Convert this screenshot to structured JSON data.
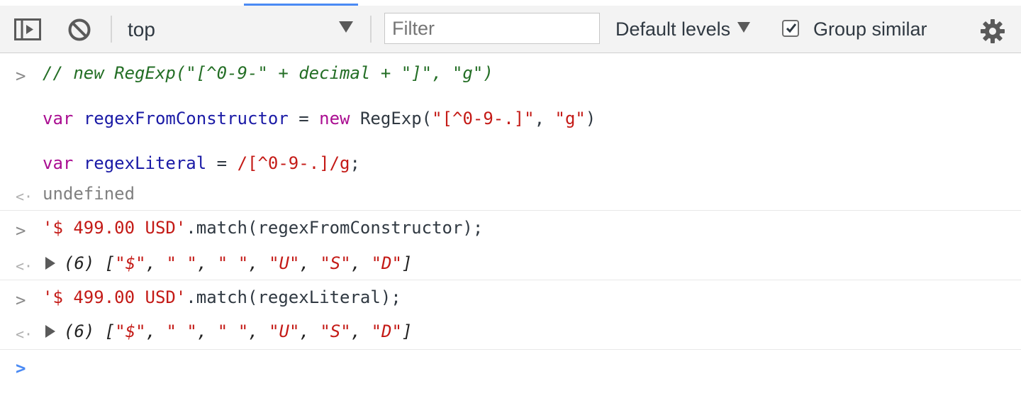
{
  "toolbar": {
    "context_label": "top",
    "filter_placeholder": "Filter",
    "levels_label": "Default levels",
    "group_similar_label": "Group similar",
    "group_similar_checked": true,
    "icons": [
      "sidebar-toggle-icon",
      "clear-console-icon",
      "dropdown-caret-icon",
      "checkbox-check-icon",
      "gear-icon"
    ]
  },
  "console": {
    "entry1": {
      "comment": "// new RegExp(\"[^0-9-\" + decimal + \"]\", \"g\")",
      "line2": {
        "kw": "var",
        "name": "regexFromConstructor",
        "eq": " = ",
        "new_kw": "new",
        "call": " RegExp(",
        "arg1": "\"[^0-9-.]\"",
        "comma": ", ",
        "arg2": "\"g\"",
        "close": ")"
      },
      "line3": {
        "kw": "var",
        "name": "regexLiteral",
        "eq": " = ",
        "regex": "/[^0-9-.]/g",
        "end": ";"
      },
      "result": "undefined"
    },
    "entry2": {
      "string": "'$ 499.00 USD'",
      "call": ".match(regexFromConstructor);",
      "result": {
        "count": "(6)",
        "open": " [",
        "items": [
          "\"$\"",
          "\" \"",
          "\" \"",
          "\"U\"",
          "\"S\"",
          "\"D\""
        ],
        "close": "]"
      }
    },
    "entry3": {
      "string": "'$ 499.00 USD'",
      "call": ".match(regexLiteral);",
      "result": {
        "count": "(6)",
        "open": " [",
        "items": [
          "\"$\"",
          "\" \"",
          "\" \"",
          "\"U\"",
          "\"S\"",
          "\"D\""
        ],
        "close": "]"
      }
    },
    "prompt_symbol": ">",
    "result_symbol": "<·"
  },
  "colors": {
    "comment": "#236e25",
    "keyword": "#aa0d91",
    "variable": "#1a1aa6",
    "string": "#c41a16",
    "prompt_active": "#4a8af4",
    "tab_accent": "#4a8af4"
  }
}
